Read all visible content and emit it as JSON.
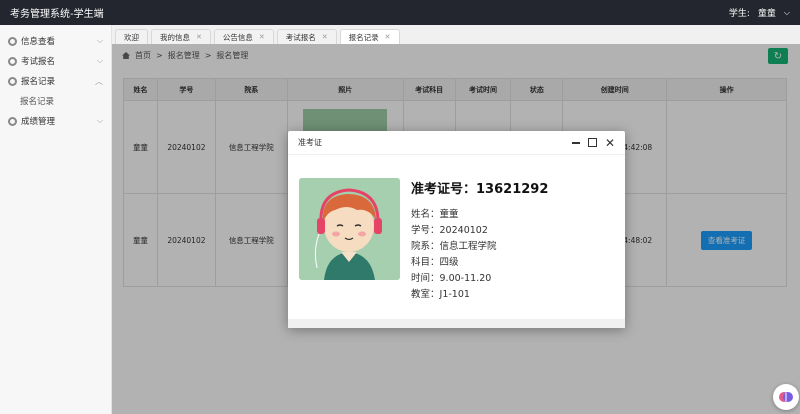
{
  "app": {
    "title": "考务管理系统-学生端",
    "user_prefix": "学生:",
    "user_name": "童童"
  },
  "sidebar": {
    "items": [
      {
        "label": "信息查看"
      },
      {
        "label": "考试报名"
      },
      {
        "label": "报名记录"
      },
      {
        "label": "成绩管理"
      }
    ],
    "sub_label": "报名记录"
  },
  "tabs": [
    {
      "label": "欢迎",
      "active": false
    },
    {
      "label": "我的信息",
      "active": false
    },
    {
      "label": "公告信息",
      "active": false
    },
    {
      "label": "考试报名",
      "active": false
    },
    {
      "label": "报名记录",
      "active": true
    }
  ],
  "breadcrumb": {
    "home": "首页",
    "level1": "报名管理",
    "level2": "报名管理",
    "sep": ">"
  },
  "table": {
    "headers": [
      "姓名",
      "学号",
      "院系",
      "照片",
      "考试科目",
      "考试时间",
      "状态",
      "创建时间",
      "操作"
    ],
    "rows": [
      {
        "name": "童童",
        "id": "20240102",
        "dept": "信息工程学院",
        "created": "2024-4-18 14:42:08",
        "action": ""
      },
      {
        "name": "童童",
        "id": "20240102",
        "dept": "信息工程学院",
        "created": "2024-4-18 14:48:02",
        "action": "查看准考证"
      }
    ]
  },
  "modal": {
    "title": "准考证",
    "ticket_label": "准考证号：",
    "ticket_no": "13621292",
    "fields": [
      {
        "label": "姓名：",
        "value": "童童"
      },
      {
        "label": "学号：",
        "value": "20240102"
      },
      {
        "label": "院系：",
        "value": "信息工程学院"
      },
      {
        "label": "科目：",
        "value": "四级"
      },
      {
        "label": "时间：",
        "value": "9.00-11.20"
      },
      {
        "label": "教室：",
        "value": "J1-101"
      }
    ]
  },
  "colors": {
    "topbar": "#23262e",
    "accent_green": "#16b777",
    "button_blue": "#1e9fff"
  }
}
